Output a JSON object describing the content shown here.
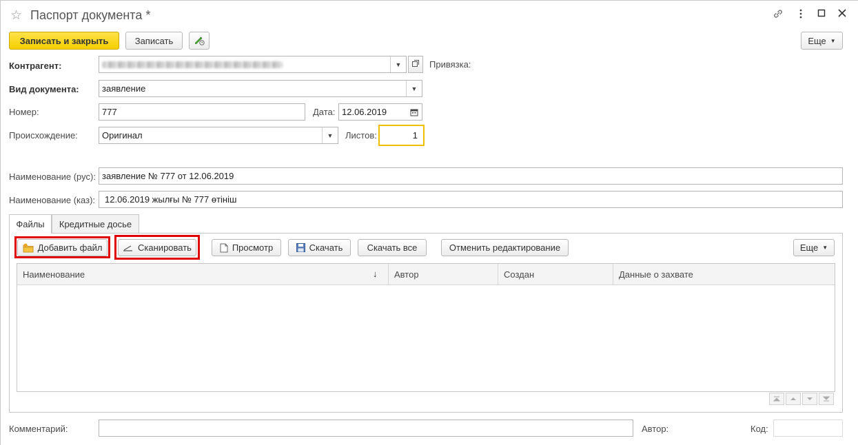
{
  "window": {
    "title": "Паспорт документа *",
    "more_label": "Еще",
    "controls": [
      "link-icon",
      "more-vert-icon",
      "maximize-icon",
      "close-icon"
    ]
  },
  "toolbar": {
    "save_close_label": "Записать и закрыть",
    "save_label": "Записать",
    "edit_icon": "pencil-clock-icon"
  },
  "form": {
    "counterparty": {
      "label": "Контрагент:",
      "value": ""
    },
    "binding_label": "Привязка:",
    "doc_type": {
      "label": "Вид документа:",
      "value": "заявление"
    },
    "number": {
      "label": "Номер:",
      "value": "777"
    },
    "date": {
      "label": "Дата:",
      "value": "12.06.2019"
    },
    "origin": {
      "label": "Происхождение:",
      "value": "Оригинал"
    },
    "sheets": {
      "label": "Листов:",
      "value": "1"
    },
    "name_ru": {
      "label": "Наименование (рус):",
      "value": "заявление № 777 от 12.06.2019"
    },
    "name_kz": {
      "label": "Наименование (каз):",
      "value": "12.06.2019 жылғы № 777 өтініш"
    },
    "comment": {
      "label": "Комментарий:",
      "value": ""
    },
    "author_label": "Автор:",
    "code_label": "Код:"
  },
  "tabs": [
    {
      "label": "Файлы",
      "active": true
    },
    {
      "label": "Кредитные досье",
      "active": false
    }
  ],
  "files_toolbar": {
    "add_file": "Добавить файл",
    "scan": "Сканировать",
    "view": "Просмотр",
    "download": "Скачать",
    "download_all": "Скачать все",
    "cancel_edit": "Отменить редактирование",
    "more": "Еще"
  },
  "table": {
    "columns": [
      "Наименование",
      "Автор",
      "Создан",
      "Данные о захвате"
    ],
    "sort_indicator": "↓",
    "rows": []
  },
  "colors": {
    "primary_button": "#f5cf00",
    "highlight": "#e00000",
    "sheets_focus": "#f0c000"
  }
}
